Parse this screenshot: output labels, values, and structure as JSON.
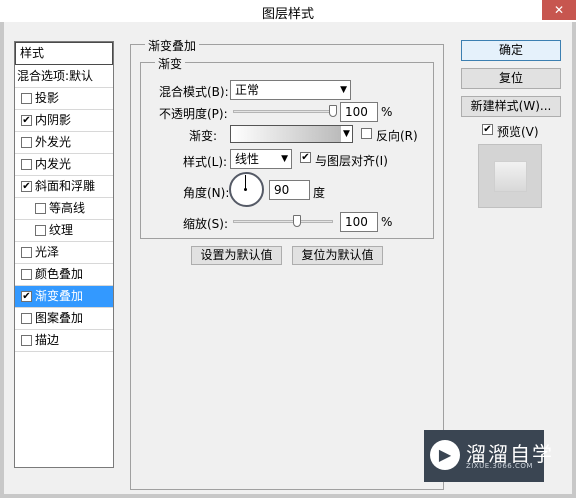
{
  "window": {
    "title": "图层样式",
    "close": "✕"
  },
  "style_list": {
    "header": "样式",
    "items": [
      {
        "label": "混合选项:默认",
        "checkbox": false
      },
      {
        "label": "投影",
        "checkbox": true,
        "checked": ""
      },
      {
        "label": "内阴影",
        "checkbox": true,
        "checked": "✔"
      },
      {
        "label": "外发光",
        "checkbox": true,
        "checked": ""
      },
      {
        "label": "内发光",
        "checkbox": true,
        "checked": ""
      },
      {
        "label": "斜面和浮雕",
        "checkbox": true,
        "checked": "✔"
      },
      {
        "label": "等高线",
        "checkbox": true,
        "checked": ""
      },
      {
        "label": "纹理",
        "checkbox": true,
        "checked": ""
      },
      {
        "label": "光泽",
        "checkbox": true,
        "checked": ""
      },
      {
        "label": "颜色叠加",
        "checkbox": true,
        "checked": ""
      },
      {
        "label": "渐变叠加",
        "checkbox": true,
        "checked": "✔"
      },
      {
        "label": "图案叠加",
        "checkbox": true,
        "checked": ""
      },
      {
        "label": "描边",
        "checkbox": true,
        "checked": ""
      }
    ]
  },
  "panel": {
    "outer_title": "渐变叠加",
    "inner_title": "渐变",
    "blend_mode_label": "混合模式(B):",
    "blend_mode_value": "正常",
    "opacity_label": "不透明度(P):",
    "opacity_value": "100",
    "opacity_unit": "%",
    "opacity_level": 1.0,
    "gradient_label": "渐变:",
    "reverse_label": "反向(R)",
    "reverse_checked": "",
    "style_label": "样式(L):",
    "style_value": "线性",
    "align_label": "与图层对齐(I)",
    "align_checked": "✔",
    "angle_label": "角度(N):",
    "angle_value": "90",
    "angle_unit": "度",
    "scale_label": "缩放(S):",
    "scale_value": "100",
    "scale_unit": "%",
    "scale_level": 0.62,
    "set_default": "设置为默认值",
    "reset_default": "复位为默认值"
  },
  "actions": {
    "ok": "确定",
    "reset": "复位",
    "new_style": "新建样式(W)...",
    "preview_label": "预览(V)",
    "preview_checked": "✔"
  },
  "watermark": {
    "name": "溜溜自学",
    "url": "ZIXUE.3066.COM"
  },
  "colors": {
    "selected_row": "#3399ff",
    "close_button": "#c7564f"
  }
}
